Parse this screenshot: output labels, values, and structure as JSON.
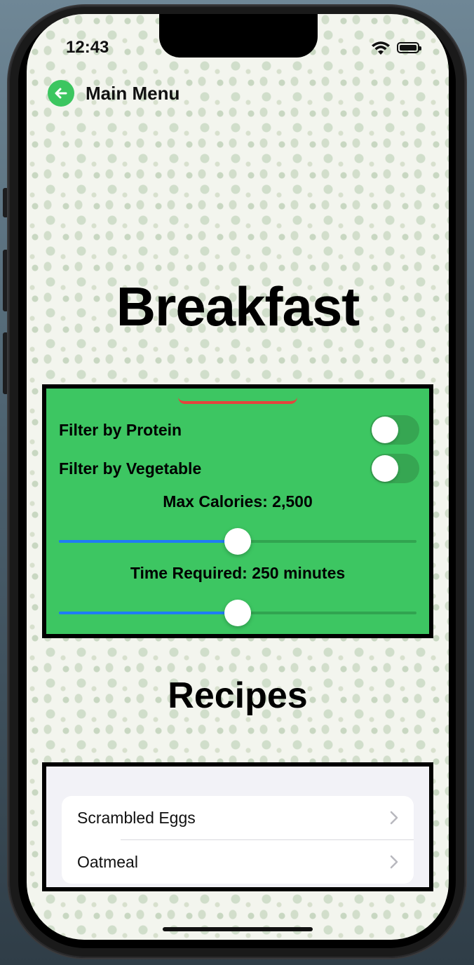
{
  "status_bar": {
    "time": "12:43"
  },
  "nav": {
    "back_label": "Main Menu"
  },
  "page": {
    "title": "Breakfast"
  },
  "filters": {
    "protein_label": "Filter by Protein",
    "protein_on": false,
    "vegetable_label": "Filter by Vegetable",
    "vegetable_on": false,
    "calories_label": "Max Calories: 2,500",
    "calories_fraction": 0.5,
    "time_label": "Time Required: 250 minutes",
    "time_fraction": 0.5
  },
  "recipes": {
    "title": "Recipes",
    "items": [
      {
        "label": "Scrambled Eggs"
      },
      {
        "label": "Oatmeal"
      }
    ]
  },
  "colors": {
    "accent_green": "#3dc662",
    "slider_blue": "#1f7cf6",
    "handle_red": "#e5443c"
  },
  "icons": [
    "back-arrow-icon",
    "wifi-icon",
    "battery-icon",
    "chevron-right-icon"
  ]
}
